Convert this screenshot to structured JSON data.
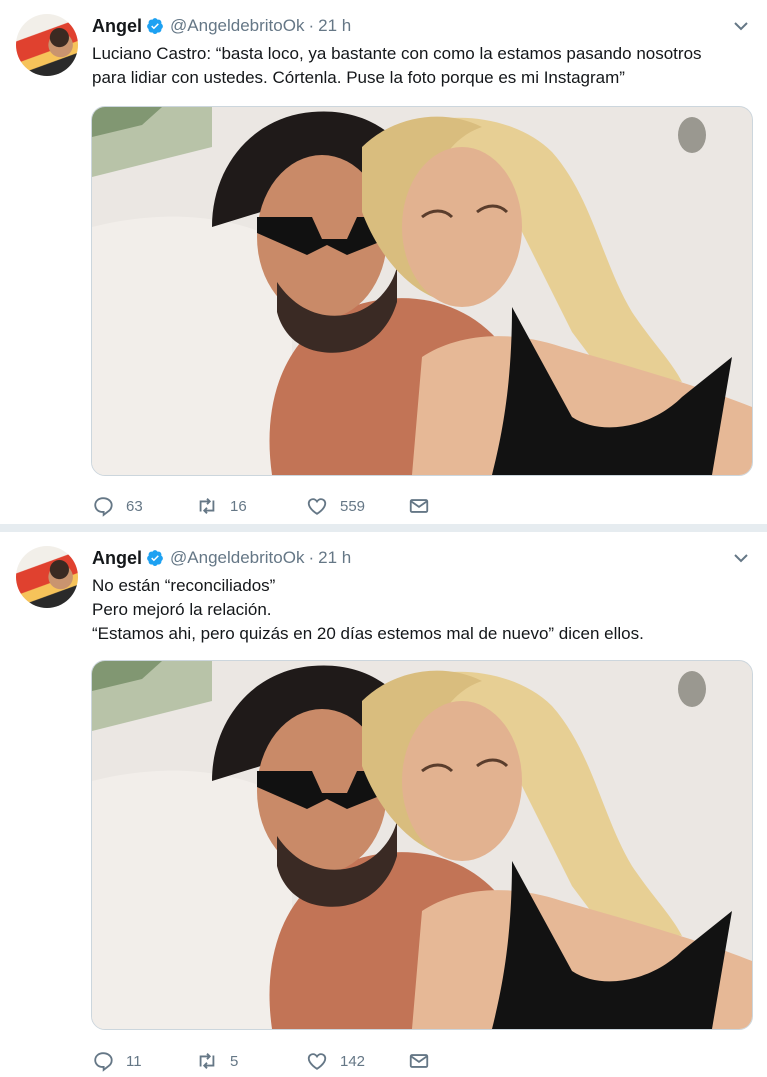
{
  "tweets": [
    {
      "author_name": "Angel",
      "handle": "@AngeldebritoOk",
      "separator": "·",
      "time": "21 h",
      "lines": [
        "Luciano Castro: “basta loco, ya bastante con como la estamos pasando nosotros",
        "para lidiar con ustedes. Córtenla. Puse la foto porque es mi Instagram”"
      ],
      "replies": "63",
      "retweets": "16",
      "likes": "559"
    },
    {
      "author_name": "Angel",
      "handle": "@AngeldebritoOk",
      "separator": "·",
      "time": "21 h",
      "lines": [
        "No están “reconciliados”",
        "Pero mejoró la relación.",
        "“Estamos ahi, pero quizás en 20 días estemos mal de nuevo” dicen ellos."
      ],
      "replies": "11",
      "retweets": "5",
      "likes": "142"
    }
  ],
  "icons": {
    "verified": "verified-badge-icon",
    "caret": "chevron-down-icon",
    "reply": "reply-icon",
    "retweet": "retweet-icon",
    "like": "heart-icon",
    "dm": "envelope-icon"
  },
  "colors": {
    "verified": "#1da1f2",
    "secondary_text": "#657786",
    "separator": "#e6ecf0"
  }
}
